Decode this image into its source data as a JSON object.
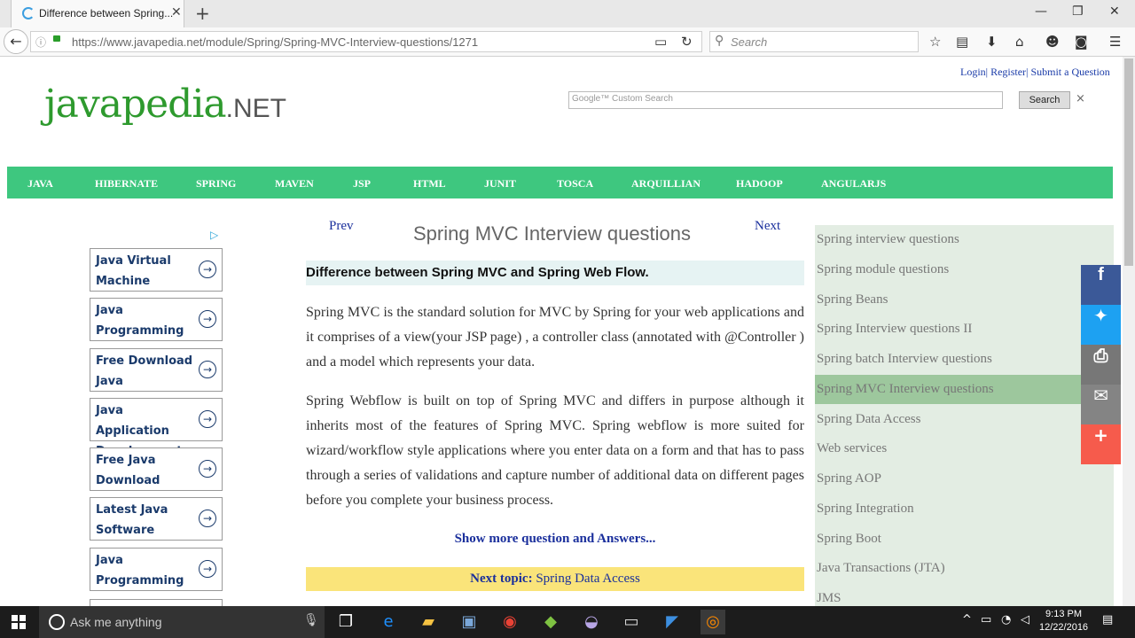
{
  "browser": {
    "tab_title": "Difference between Spring...",
    "url": "https://www.javapedia.net/module/Spring/Spring-MVC-Interview-questions/1271",
    "search_placeholder": "Search"
  },
  "site": {
    "logo_main": "javapedia",
    "logo_suffix": ".NET",
    "top_links": "Login| Register| Submit a Question",
    "custom_search_placeholder": "Google™ Custom Search",
    "search_button": "Search",
    "clear_button": "×"
  },
  "menu": [
    "JAVA",
    "HIBERNATE",
    "SPRING",
    "MAVEN",
    "JSP",
    "HTML",
    "JUNIT",
    "TOSCA",
    "ARQUILLIAN",
    "HADOOP",
    "ANGULARJS"
  ],
  "ads": [
    "Java Virtual Machine",
    "Java Programming",
    "Free Download Java",
    "Java Application Development",
    "Free Java Download",
    "Latest Java Software",
    "Java Programming"
  ],
  "content": {
    "prev": "Prev",
    "next": "Next",
    "title": "Spring MVC Interview questions",
    "question": "Difference between Spring MVC and Spring Web Flow.",
    "para1": "Spring MVC is the standard solution for MVC by Spring for your web applications and it comprises of a view(your JSP page) , a controller class (annotated with @Controller ) and a model which represents your data.",
    "para2": "Spring Webflow is built on top of Spring MVC and differs in purpose although it inherits most of the features of Spring MVC. Spring webflow is more suited for wizard/workflow style applications where you enter data on a form and that has to pass through a series of validations and capture number of additional data on different pages before you complete your business process.",
    "show_more": "Show more question and Answers...",
    "next_topic_label": "Next topic:",
    "next_topic_value": "Spring Data Access"
  },
  "sidebar": {
    "items": [
      "Spring interview questions",
      "Spring module questions",
      "Spring Beans",
      "Spring Interview questions II",
      "Spring batch Interview questions",
      "Spring MVC Interview questions",
      "Spring Data Access",
      "Web services",
      "Spring AOP",
      "Spring Integration",
      "Spring Boot",
      "Java Transactions (JTA)",
      "JMS"
    ],
    "active_index": 5
  },
  "share": {
    "icons": [
      "facebook-icon",
      "twitter-icon",
      "print-icon",
      "email-icon",
      "plus-icon"
    ],
    "colors": [
      "#3b5998",
      "#1da1f2",
      "#777777",
      "#848484",
      "#f65b4c"
    ]
  },
  "taskbar": {
    "search_placeholder": "Ask me anything",
    "time": "9:13 PM",
    "date": "12/22/2016"
  },
  "colors": {
    "menu_bar": "#3ec77f",
    "sidebar_bg": "#e3ede3",
    "sidebar_active": "#9dc79d",
    "next_topic_bg": "#fae47a",
    "logo_green": "#2e9a2e"
  }
}
